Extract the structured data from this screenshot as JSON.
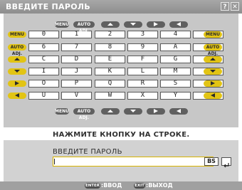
{
  "title": "ВВЕДИТЕ ПАРОЛЬ",
  "title_buttons": {
    "help": "?",
    "close": "✕"
  },
  "nav_chips": [
    {
      "label": "MENU",
      "icon": "menu"
    },
    {
      "label": "AUTO ADJ.",
      "icon": "auto-adjust"
    },
    {
      "label": "",
      "icon": "up-arrow"
    },
    {
      "label": "",
      "icon": "down-arrow"
    },
    {
      "label": "",
      "icon": "right-arrow"
    },
    {
      "label": "",
      "icon": "left-arrow"
    }
  ],
  "side_buttons": [
    {
      "label": "MENU",
      "icon": "menu"
    },
    {
      "label": "AUTO ADJ.",
      "icon": "auto-adjust"
    },
    {
      "label": "",
      "icon": "up-arrow"
    },
    {
      "label": "",
      "icon": "down-arrow"
    },
    {
      "label": "",
      "icon": "right-arrow"
    },
    {
      "label": "",
      "icon": "left-arrow"
    }
  ],
  "keys": [
    [
      "0",
      "1",
      "2",
      "3",
      "4",
      "5"
    ],
    [
      "6",
      "7",
      "8",
      "9",
      "A",
      "B"
    ],
    [
      "C",
      "D",
      "E",
      "F",
      "G",
      "H"
    ],
    [
      "I",
      "J",
      "K",
      "L",
      "M",
      "N"
    ],
    [
      "O",
      "P",
      "Q",
      "R",
      "S",
      "T"
    ],
    [
      "U",
      "V",
      "W",
      "X",
      "Y",
      "Z"
    ]
  ],
  "instruction": "НАЖМИТЕ КНОПКУ НА СТРОКЕ.",
  "password": {
    "label": "ВВЕДИТЕ ПАРОЛЬ",
    "value": "",
    "backspace_label": "BS"
  },
  "footer": {
    "enter_badge": "ENTER",
    "enter_text": ":ВВОД",
    "exit_badge": "EXIT",
    "exit_text": ":ВЫХОД"
  },
  "colors": {
    "accent": "#e2c414",
    "panel": "#c7c7c7",
    "titlebar": "#9a9a9a"
  }
}
